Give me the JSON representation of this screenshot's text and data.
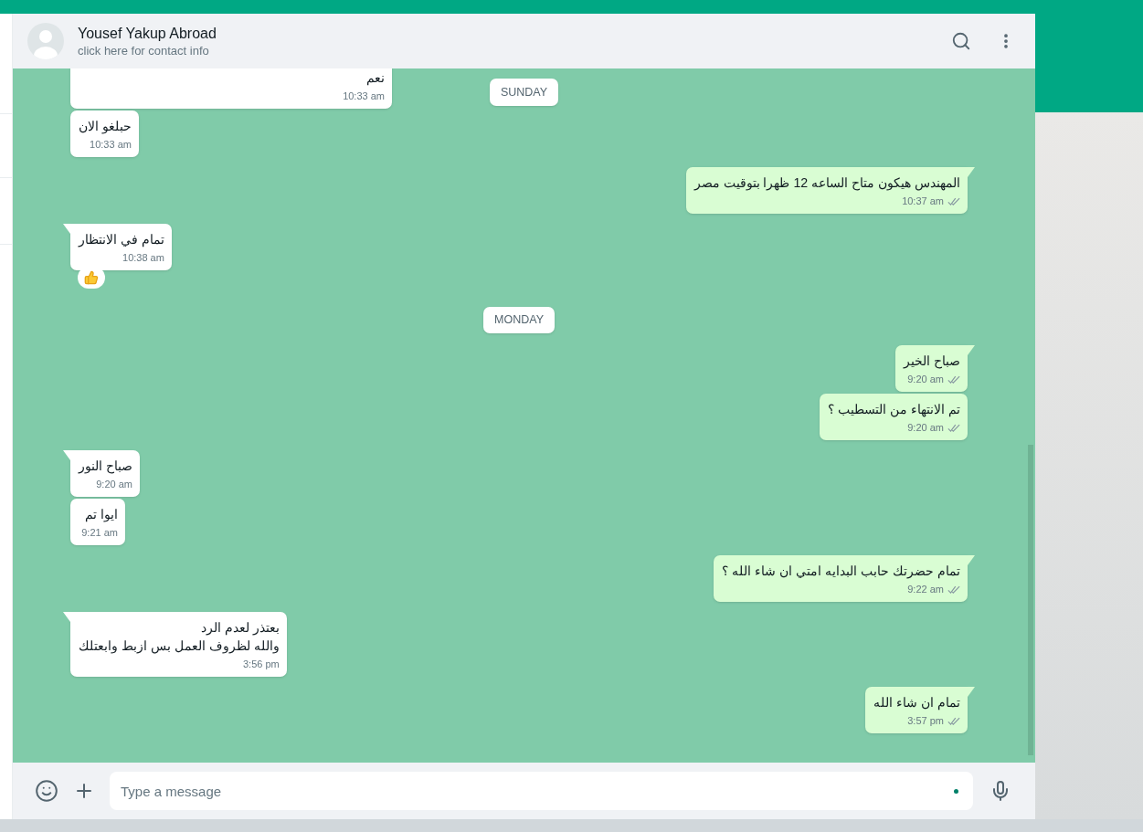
{
  "contact": {
    "name": "Yousef Yakup Abroad",
    "subtitle": "click here for contact info"
  },
  "sticky_date": "SUNDAY",
  "timeline": [
    {
      "kind": "message",
      "outgoing": false,
      "text": "نعم",
      "time": "10:33 am"
    },
    {
      "kind": "message",
      "outgoing": false,
      "text": "حبلغو الان",
      "time": "10:33 am"
    },
    {
      "kind": "message",
      "outgoing": true,
      "text": "المهندس هيكون متاح الساعه 12 ظهرا بتوقيت مصر",
      "time": "10:37 am",
      "read": false
    },
    {
      "kind": "message",
      "outgoing": false,
      "text": "تمام في الانتظار",
      "time": "10:38 am",
      "liked": true
    },
    {
      "kind": "date",
      "label": "MONDAY"
    },
    {
      "kind": "message",
      "outgoing": true,
      "text": "صباح الخير",
      "time": "9:20 am",
      "read": false
    },
    {
      "kind": "message",
      "outgoing": true,
      "text": "تم الانتهاء من التسطيب ؟",
      "time": "9:20 am",
      "read": false
    },
    {
      "kind": "message",
      "outgoing": false,
      "text": "صباح النور",
      "time": "9:20 am"
    },
    {
      "kind": "message",
      "outgoing": false,
      "text": "ايوا تم",
      "time": "9:21 am"
    },
    {
      "kind": "message",
      "outgoing": true,
      "text": "تمام حضرتك حابب البدايه امتي ان شاء الله ؟",
      "time": "9:22 am",
      "read": false
    },
    {
      "kind": "message",
      "outgoing": false,
      "text": "بعتذر لعدم الرد\nوالله لظروف العمل بس ازبط وابعتلك",
      "time": "3:56 pm"
    },
    {
      "kind": "message",
      "outgoing": true,
      "text": "تمام ان شاء الله",
      "time": "3:57 pm",
      "read": false
    }
  ],
  "composer": {
    "placeholder": "Type a message"
  }
}
